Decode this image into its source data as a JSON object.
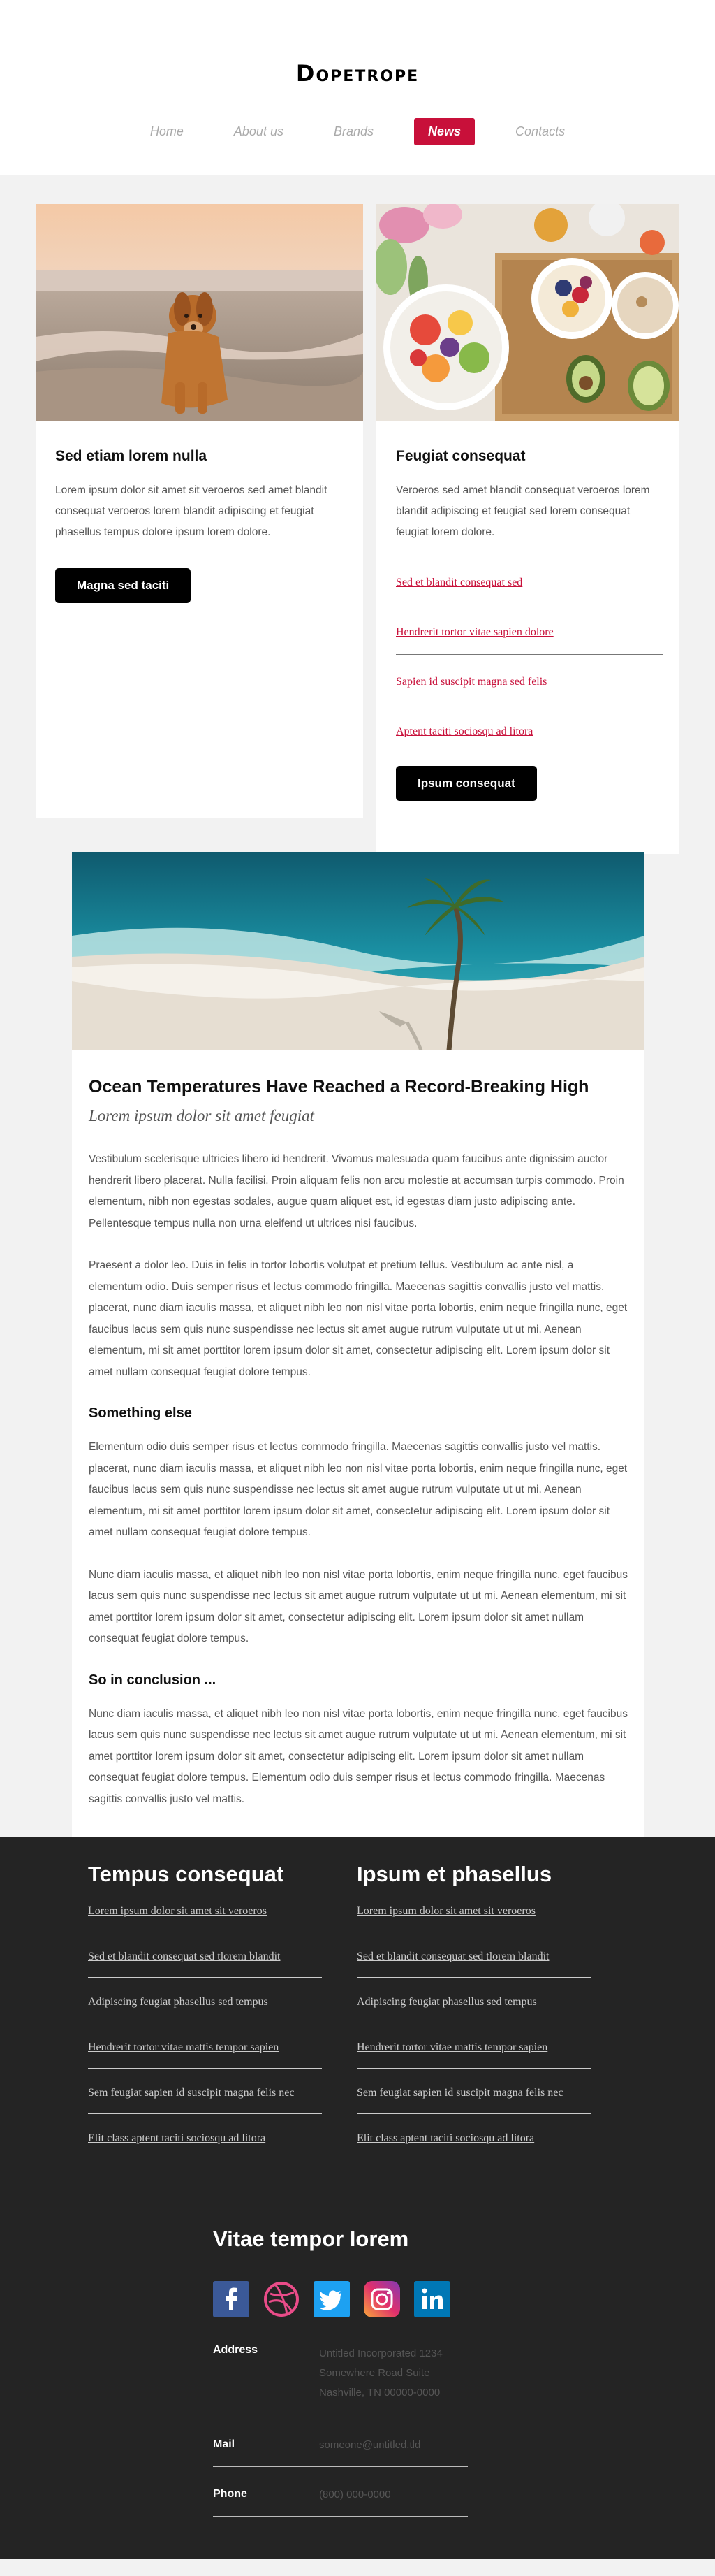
{
  "header": {
    "logo": "Dopetrope",
    "nav": [
      {
        "label": "Home"
      },
      {
        "label": "About us"
      },
      {
        "label": "Brands"
      },
      {
        "label": "News"
      },
      {
        "label": "Contacts"
      }
    ]
  },
  "cards": {
    "left": {
      "title": "Sed etiam lorem nulla",
      "text": "Lorem ipsum dolor sit amet sit veroeros sed amet blandit consequat veroeros lorem blandit adipiscing et feugiat phasellus tempus dolore ipsum lorem dolore.",
      "button": "Magna sed taciti"
    },
    "right": {
      "title": "Feugiat consequat",
      "text": "Veroeros sed amet blandit consequat veroeros lorem blandit adipiscing et feugiat sed lorem consequat feugiat lorem dolore.",
      "links": [
        "Sed et blandit consequat sed",
        "Hendrerit tortor vitae sapien dolore",
        "Sapien id suscipit magna sed felis",
        "Aptent taciti sociosqu ad litora"
      ],
      "button": "Ipsum consequat"
    }
  },
  "article": {
    "title": "Ocean Temperatures Have Reached a Record-Breaking High",
    "subtitle": "Lorem ipsum dolor sit amet feugiat",
    "p1": "Vestibulum scelerisque ultricies libero id hendrerit. Vivamus malesuada quam faucibus ante dignissim auctor hendrerit libero placerat. Nulla facilisi. Proin aliquam felis non arcu molestie at accumsan turpis commodo. Proin elementum, nibh non egestas sodales, augue quam aliquet est, id egestas diam justo adipiscing ante. Pellentesque tempus nulla non urna eleifend ut ultrices nisi faucibus.",
    "p2": "Praesent a dolor leo. Duis in felis in tortor lobortis volutpat et pretium tellus. Vestibulum ac ante nisl, a elementum odio. Duis semper risus et lectus commodo fringilla. Maecenas sagittis convallis justo vel mattis. placerat, nunc diam iaculis massa, et aliquet nibh leo non nisl vitae porta lobortis, enim neque fringilla nunc, eget faucibus lacus sem quis nunc suspendisse nec lectus sit amet augue rutrum vulputate ut ut mi. Aenean elementum, mi sit amet porttitor lorem ipsum dolor sit amet, consectetur adipiscing elit. Lorem ipsum dolor sit amet nullam consequat feugiat dolore tempus.",
    "h2": "Something else",
    "p3": "Elementum odio duis semper risus et lectus commodo fringilla. Maecenas sagittis convallis justo vel mattis. placerat, nunc diam iaculis massa, et aliquet nibh leo non nisl vitae porta lobortis, enim neque fringilla nunc, eget faucibus lacus sem quis nunc suspendisse nec lectus sit amet augue rutrum vulputate ut ut mi. Aenean elementum, mi sit amet porttitor lorem ipsum dolor sit amet, consectetur adipiscing elit. Lorem ipsum dolor sit amet nullam consequat feugiat dolore tempus.",
    "p4": "Nunc diam iaculis massa, et aliquet nibh leo non nisl vitae porta lobortis, enim neque fringilla nunc, eget faucibus lacus sem quis nunc suspendisse nec lectus sit amet augue rutrum vulputate ut ut mi. Aenean elementum, mi sit amet porttitor lorem ipsum dolor sit amet, consectetur adipiscing elit. Lorem ipsum dolor sit amet nullam consequat feugiat dolore tempus.",
    "h3": "So in conclusion ...",
    "p5": "Nunc diam iaculis massa, et aliquet nibh leo non nisl vitae porta lobortis, enim neque fringilla nunc, eget faucibus lacus sem quis nunc suspendisse nec lectus sit amet augue rutrum vulputate ut ut mi. Aenean elementum, mi sit amet porttitor lorem ipsum dolor sit amet, consectetur adipiscing elit. Lorem ipsum dolor sit amet nullam consequat feugiat dolore tempus. Elementum odio duis semper risus et lectus commodo fringilla. Maecenas sagittis convallis justo vel mattis."
  },
  "footer": {
    "col1": {
      "title": "Tempus consequat",
      "links": [
        "Lorem ipsum dolor sit amet sit veroeros",
        "Sed et blandit consequat sed tlorem blandit",
        "Adipiscing feugiat phasellus sed tempus",
        "Hendrerit tortor vitae mattis tempor sapien",
        "Sem feugiat sapien id suscipit magna felis nec",
        "Elit class aptent taciti sociosqu ad litora"
      ]
    },
    "col2": {
      "title": "Ipsum et phasellus",
      "links": [
        "Lorem ipsum dolor sit amet sit veroeros",
        "Sed et blandit consequat sed tlorem blandit",
        "Adipiscing feugiat phasellus sed tempus",
        "Hendrerit tortor vitae mattis tempor sapien",
        "Sem feugiat sapien id suscipit magna felis nec",
        "Elit class aptent taciti sociosqu ad litora"
      ]
    },
    "contact": {
      "title": "Vitae tempor lorem",
      "socials": [
        "facebook-icon",
        "dribbble-icon",
        "twitter-icon",
        "instagram-icon",
        "linkedin-icon"
      ],
      "address_label": "Address",
      "address_lines": [
        "Untitled Incorporated 1234",
        "Somewhere Road Suite",
        "Nashville, TN 00000-0000"
      ],
      "mail_label": "Mail",
      "mail": "someone@untitled.tld",
      "phone_label": "Phone",
      "phone": "(800) 000-0000"
    }
  },
  "colors": {
    "accent": "#c8103a",
    "footer_bg": "#242424",
    "page_bg": "#f2f2f2"
  }
}
